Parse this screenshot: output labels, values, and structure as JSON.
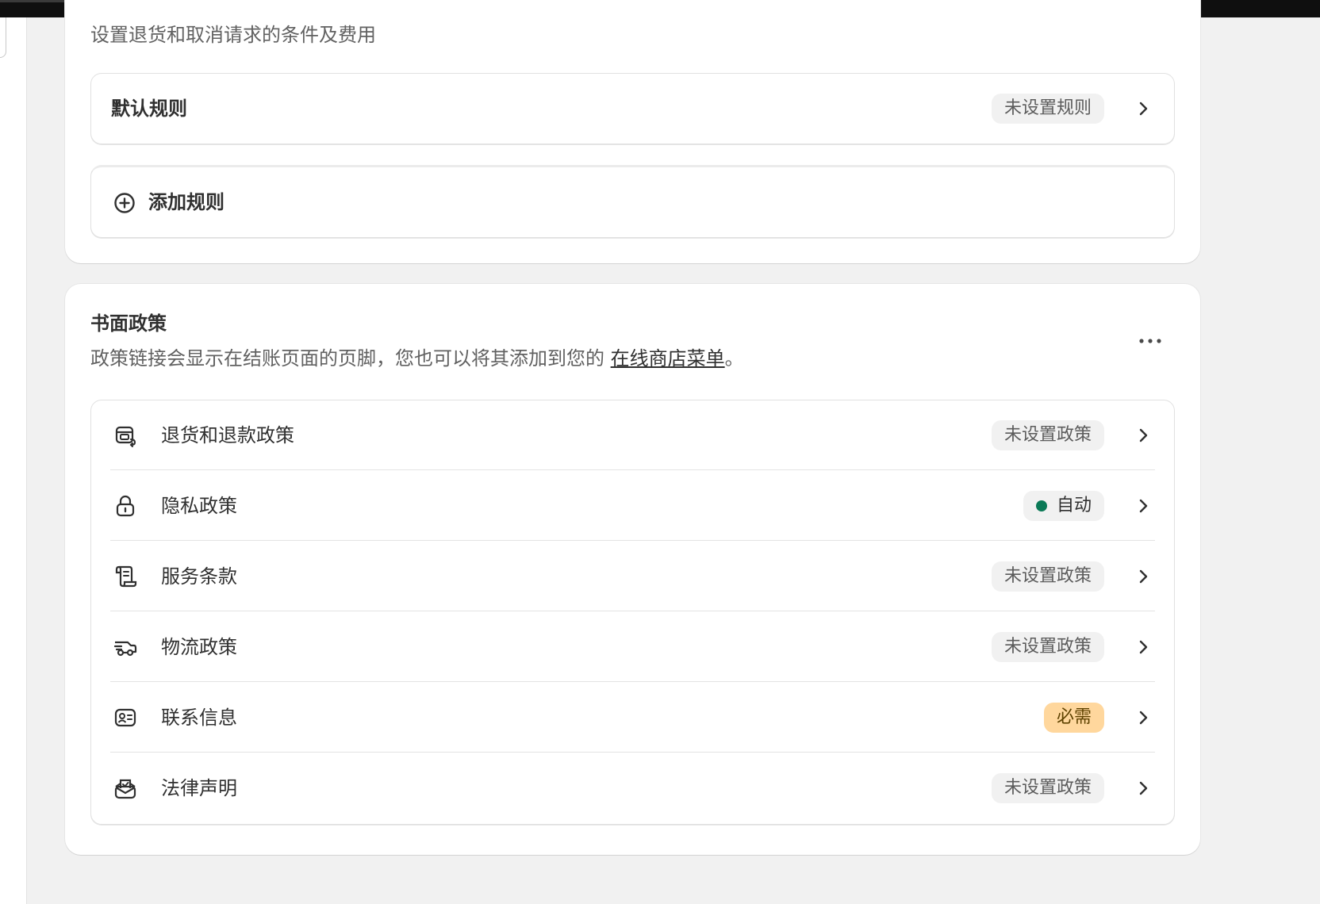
{
  "return_rules": {
    "description": "设置退货和取消请求的条件及费用",
    "default_rule": {
      "label": "默认规则",
      "badge": "未设置规则"
    },
    "add_rule": {
      "label": "添加规则"
    }
  },
  "written_policies": {
    "title": "书面政策",
    "description_prefix": "政策链接会显示在结账页面的页脚，您也可以将其添加到您的 ",
    "description_link": "在线商店菜单",
    "description_suffix": "。",
    "items": [
      {
        "label": "退货和退款政策",
        "badge": "未设置政策",
        "badge_type": "neutral",
        "icon": "return-box-icon"
      },
      {
        "label": "隐私政策",
        "badge": "自动",
        "badge_type": "auto",
        "icon": "lock-icon"
      },
      {
        "label": "服务条款",
        "badge": "未设置政策",
        "badge_type": "neutral",
        "icon": "scroll-icon"
      },
      {
        "label": "物流政策",
        "badge": "未设置政策",
        "badge_type": "neutral",
        "icon": "truck-icon"
      },
      {
        "label": "联系信息",
        "badge": "必需",
        "badge_type": "required",
        "icon": "id-card-icon"
      },
      {
        "label": "法律声明",
        "badge": "未设置政策",
        "badge_type": "neutral",
        "icon": "envelope-icon"
      }
    ]
  },
  "colors": {
    "page_bg": "#f1f1f1",
    "card_bg": "#ffffff",
    "auto_dot": "#0b7a57",
    "required_badge_bg": "#ffd79d",
    "required_badge_text": "#5e4200"
  }
}
